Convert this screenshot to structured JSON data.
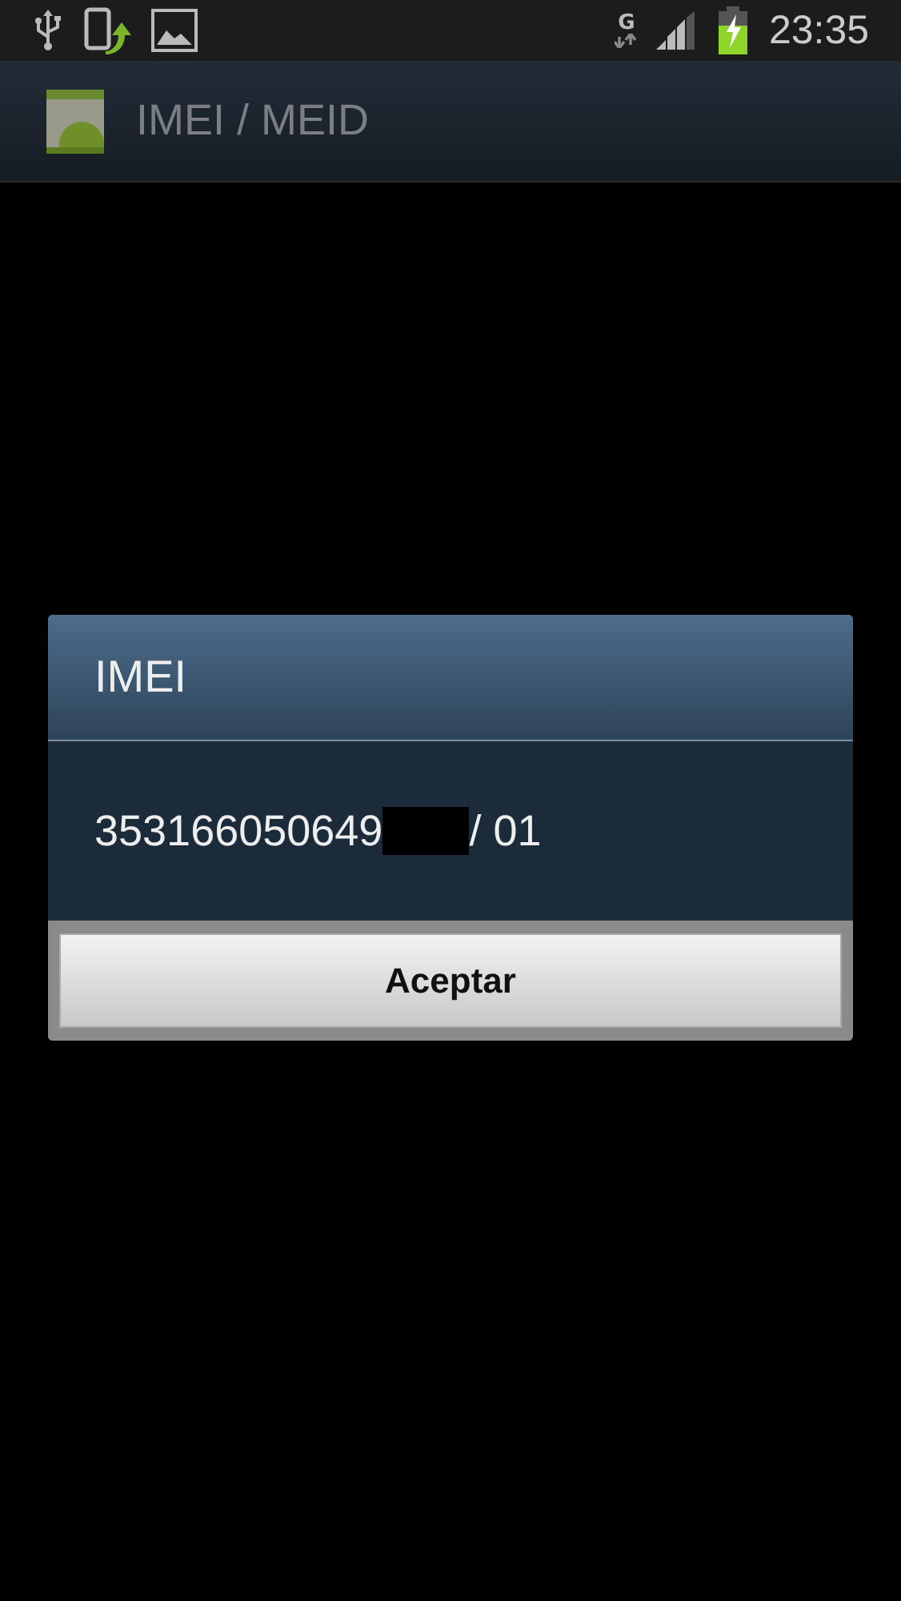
{
  "status_bar": {
    "network": "G",
    "time": "23:35"
  },
  "action_bar": {
    "title": "IMEI / MEID"
  },
  "dialog": {
    "title": "IMEI",
    "value": "353166050649",
    "suffix": "/ 01",
    "buttons": [
      "Aceptar"
    ]
  }
}
